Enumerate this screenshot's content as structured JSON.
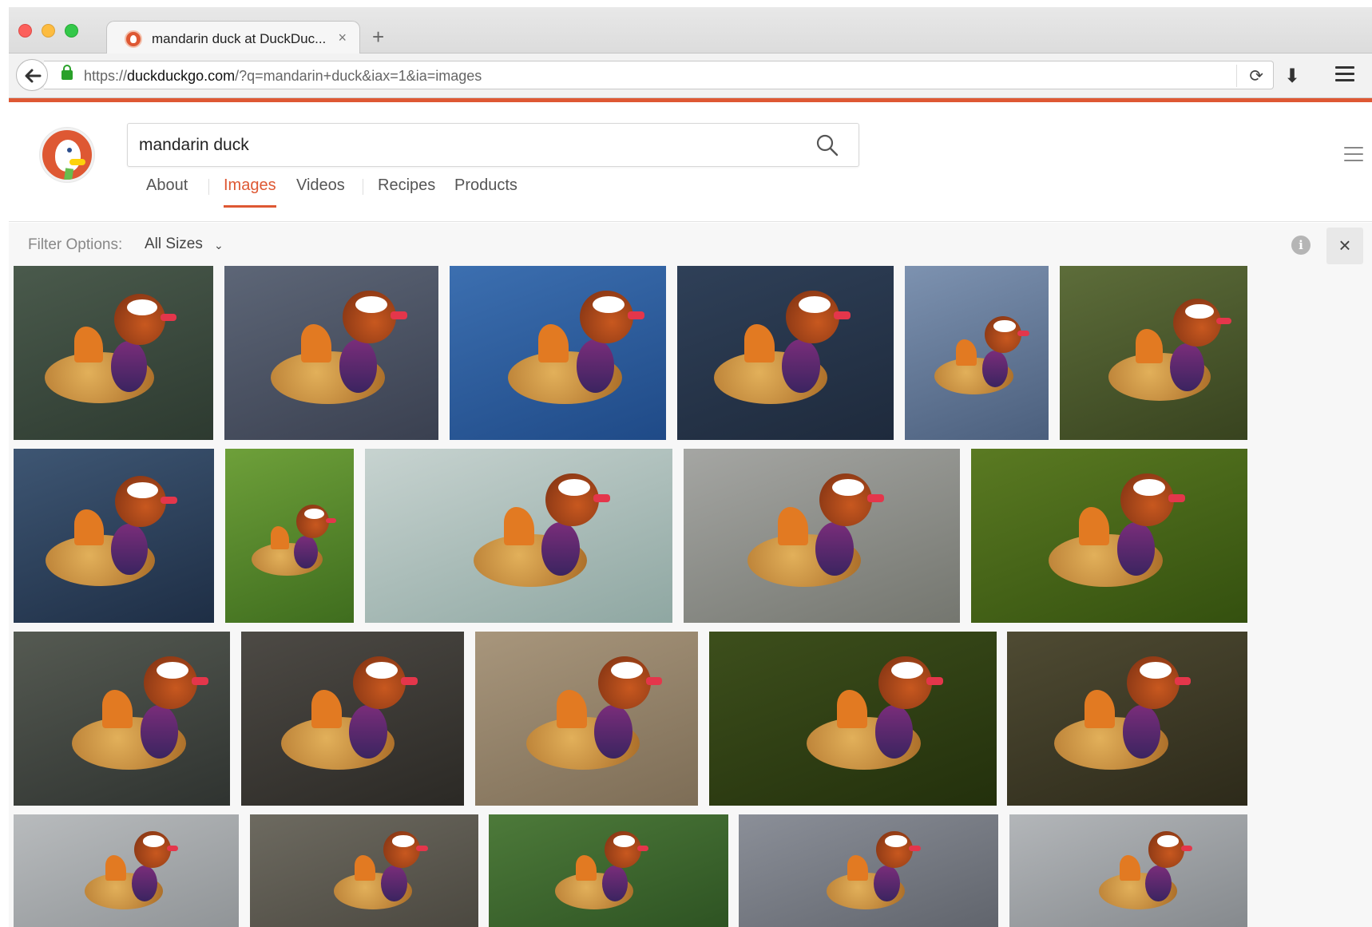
{
  "browser": {
    "tab_title": "mandarin duck at DuckDuc...",
    "tab_close": "×",
    "new_tab": "+",
    "url_prefix": "https://",
    "url_domain": "duckduckgo.com",
    "url_path": "/?q=mandarin+duck&iax=1&ia=images",
    "reload_glyph": "⟳",
    "download_glyph": "⬇"
  },
  "search": {
    "query": "mandarin duck"
  },
  "nav": {
    "about": "About",
    "images": "Images",
    "videos": "Videos",
    "recipes": "Recipes",
    "products": "Products",
    "active": "Images"
  },
  "filter": {
    "label": "Filter Options:",
    "size_value": "All Sizes",
    "chevron": "⌄",
    "info_glyph": "i",
    "close_glyph": "×"
  },
  "colors": {
    "accent": "#de5833",
    "active_tab": "#de5833"
  },
  "results": {
    "image_alt": "mandarin duck"
  }
}
